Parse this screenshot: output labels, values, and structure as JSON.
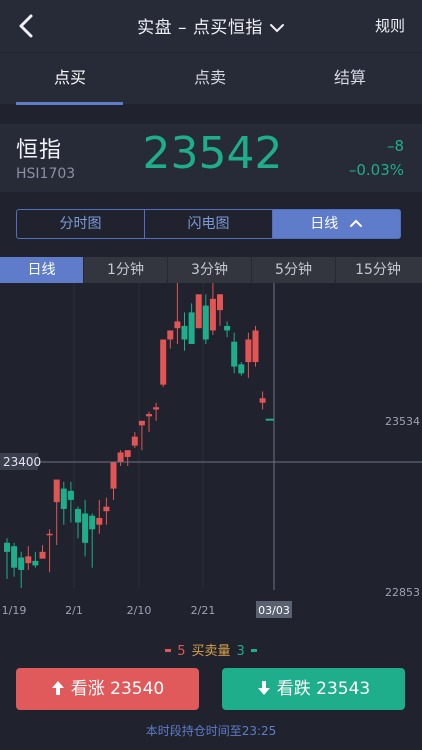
{
  "header": {
    "title": "实盘 – 点买恒指",
    "rules_label": "规则"
  },
  "tabs": [
    {
      "label": "点买"
    },
    {
      "label": "点卖"
    },
    {
      "label": "结算"
    }
  ],
  "quote": {
    "name": "恒指",
    "code": "HSI1703",
    "price": "23542",
    "change": "–8",
    "change_pct": "–0.03%",
    "color": "#1fae8b"
  },
  "chart_modes": [
    {
      "label": "分时图"
    },
    {
      "label": "闪电图"
    },
    {
      "label": "日线"
    }
  ],
  "periods": [
    {
      "label": "日线"
    },
    {
      "label": "1分钟"
    },
    {
      "label": "3分钟"
    },
    {
      "label": "5分钟"
    },
    {
      "label": "15分钟"
    }
  ],
  "chart_data": {
    "type": "candlestick",
    "y_labels": {
      "upper": "23534",
      "lower": "22853"
    },
    "crosshair": {
      "y_label": "23400",
      "x_label": "03/03"
    },
    "x_labels": [
      "1/19",
      "2/1",
      "2/10",
      "2/21"
    ],
    "up_color": "#e25555",
    "down_color": "#1fae8b",
    "ylim": [
      22800,
      24150
    ],
    "candles": [
      {
        "o": 23000,
        "h": 23020,
        "l": 22840,
        "c": 22960
      },
      {
        "o": 22985,
        "h": 23000,
        "l": 22850,
        "c": 22890
      },
      {
        "o": 22935,
        "h": 22960,
        "l": 22800,
        "c": 22880
      },
      {
        "o": 22910,
        "h": 22985,
        "l": 22880,
        "c": 22940
      },
      {
        "o": 22920,
        "h": 22960,
        "l": 22890,
        "c": 22900
      },
      {
        "o": 22930,
        "h": 22990,
        "l": 22930,
        "c": 22960
      },
      {
        "o": 23040,
        "h": 23060,
        "l": 22870,
        "c": 23040
      },
      {
        "o": 23180,
        "h": 23230,
        "l": 22990,
        "c": 23280
      },
      {
        "o": 23240,
        "h": 23270,
        "l": 23080,
        "c": 23150
      },
      {
        "o": 23230,
        "h": 23270,
        "l": 23090,
        "c": 23190
      },
      {
        "o": 23150,
        "h": 23160,
        "l": 23020,
        "c": 23090
      },
      {
        "o": 23130,
        "h": 23190,
        "l": 22940,
        "c": 23000
      },
      {
        "o": 23120,
        "h": 23130,
        "l": 22890,
        "c": 23060
      },
      {
        "o": 23080,
        "h": 23190,
        "l": 23040,
        "c": 23110
      },
      {
        "o": 23140,
        "h": 23200,
        "l": 23080,
        "c": 23160
      },
      {
        "o": 23240,
        "h": 23310,
        "l": 23190,
        "c": 23360
      },
      {
        "o": 23360,
        "h": 23410,
        "l": 23340,
        "c": 23400
      },
      {
        "o": 23380,
        "h": 23400,
        "l": 23340,
        "c": 23410
      },
      {
        "o": 23430,
        "h": 23490,
        "l": 23420,
        "c": 23470
      },
      {
        "o": 23520,
        "h": 23530,
        "l": 23410,
        "c": 23540
      },
      {
        "o": 23560,
        "h": 23580,
        "l": 23490,
        "c": 23570
      },
      {
        "o": 23590,
        "h": 23620,
        "l": 23540,
        "c": 23600
      },
      {
        "o": 23700,
        "h": 23740,
        "l": 23690,
        "c": 23900
      },
      {
        "o": 23900,
        "h": 23920,
        "l": 23860,
        "c": 23940
      },
      {
        "o": 23950,
        "h": 24150,
        "l": 23880,
        "c": 23980
      },
      {
        "o": 23960,
        "h": 24020,
        "l": 23850,
        "c": 23900
      },
      {
        "o": 24020,
        "h": 24060,
        "l": 23960,
        "c": 23880
      },
      {
        "o": 23950,
        "h": 24100,
        "l": 23950,
        "c": 24100
      },
      {
        "o": 24050,
        "h": 24100,
        "l": 23880,
        "c": 23900
      },
      {
        "o": 23940,
        "h": 24150,
        "l": 23920,
        "c": 24080
      },
      {
        "o": 24030,
        "h": 24100,
        "l": 23960,
        "c": 24100
      },
      {
        "o": 23960,
        "h": 23980,
        "l": 23910,
        "c": 23940
      },
      {
        "o": 23890,
        "h": 23930,
        "l": 23750,
        "c": 23780
      },
      {
        "o": 23790,
        "h": 23800,
        "l": 23740,
        "c": 23750
      },
      {
        "o": 23800,
        "h": 23930,
        "l": 23730,
        "c": 23900
      },
      {
        "o": 23800,
        "h": 23960,
        "l": 23780,
        "c": 23940
      },
      {
        "o": 23620,
        "h": 23670,
        "l": 23590,
        "c": 23640
      }
    ],
    "last_tick": 23545
  },
  "volume_legend": {
    "buy": "5",
    "label": "买卖量",
    "sell": "3"
  },
  "buttons": {
    "up_label": "看涨 23540",
    "down_label": "看跌 23543"
  },
  "footnote": "本时段持仓时间至23:25"
}
